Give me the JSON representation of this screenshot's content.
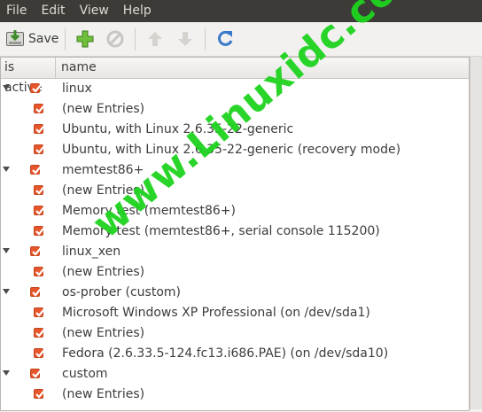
{
  "menubar": {
    "items": [
      "File",
      "Edit",
      "View",
      "Help"
    ]
  },
  "toolbar": {
    "save_label": "Save"
  },
  "tree": {
    "columns": {
      "active": "is active",
      "name": "name"
    },
    "rows": [
      {
        "label": "linux",
        "level": 0,
        "active": true
      },
      {
        "label": "(new Entries)",
        "level": 1,
        "active": true
      },
      {
        "label": "Ubuntu, with Linux 2.6.35-22-generic",
        "level": 1,
        "active": true
      },
      {
        "label": "Ubuntu, with Linux 2.6.35-22-generic (recovery mode)",
        "level": 1,
        "active": true
      },
      {
        "label": "memtest86+",
        "level": 0,
        "active": true
      },
      {
        "label": "(new Entries)",
        "level": 1,
        "active": true
      },
      {
        "label": "Memory test (memtest86+)",
        "level": 1,
        "active": true
      },
      {
        "label": "Memory test (memtest86+, serial console 115200)",
        "level": 1,
        "active": true
      },
      {
        "label": "linux_xen",
        "level": 0,
        "active": true
      },
      {
        "label": "(new Entries)",
        "level": 1,
        "active": true
      },
      {
        "label": "os-prober (custom)",
        "level": 0,
        "active": true
      },
      {
        "label": "Microsoft Windows XP Professional (on /dev/sda1)",
        "level": 1,
        "active": true
      },
      {
        "label": "(new Entries)",
        "level": 1,
        "active": true
      },
      {
        "label": "Fedora (2.6.33.5-124.fc13.i686.PAE) (on /dev/sda10)",
        "level": 1,
        "active": true
      },
      {
        "label": "custom",
        "level": 0,
        "active": true
      },
      {
        "label": "(new Entries)",
        "level": 1,
        "active": true
      }
    ]
  },
  "watermark": "www.Linuxidc.com",
  "colors": {
    "menubar": "#3c3b37",
    "checkbox": "#e6562a",
    "watermark": "#1fd31f"
  }
}
